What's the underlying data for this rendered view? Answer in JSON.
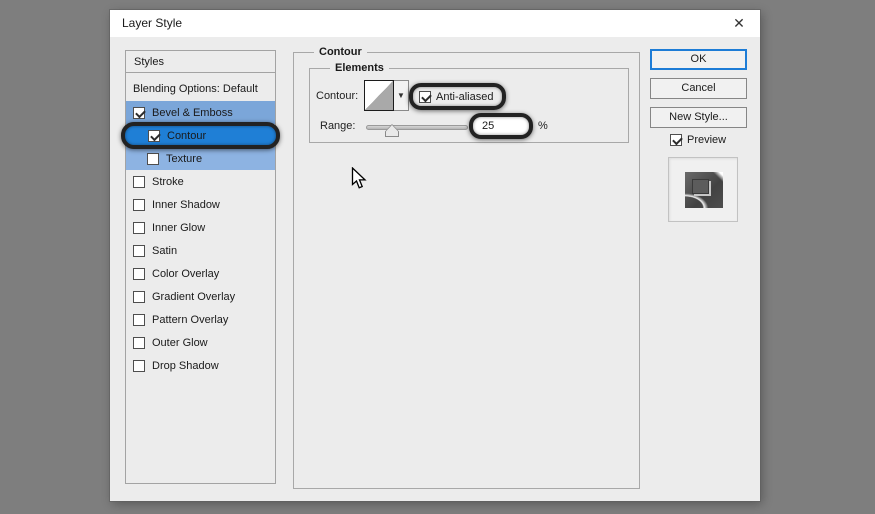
{
  "window": {
    "title": "Layer Style"
  },
  "icons": {
    "close": "✕",
    "dropdown_arrow": "▼"
  },
  "colors": {
    "desktop_background": "#7e7e7e",
    "dialog_background": "#ececec",
    "titlebar_background": "#ffffff",
    "selected_row_blue": "#1f7fd6",
    "group_row_blue": "#7ba6d9",
    "sub_row_blue": "#8db3e2",
    "annotation_ring": "#222222",
    "ok_focus_border": "#1d7cd6"
  },
  "sidebar": {
    "header": "Styles",
    "items": [
      {
        "label": "Blending Options: Default",
        "checkbox": null,
        "highlight": null,
        "indent": false,
        "annotated": false
      },
      {
        "label": "Bevel & Emboss",
        "checkbox": true,
        "highlight": "#7ba6d9",
        "indent": false,
        "annotated": false
      },
      {
        "label": "Contour",
        "checkbox": true,
        "highlight": "#1f7fd6",
        "indent": true,
        "annotated": true
      },
      {
        "label": "Texture",
        "checkbox": false,
        "highlight": "#8db3e2",
        "indent": true,
        "annotated": false
      },
      {
        "label": "Stroke",
        "checkbox": false,
        "highlight": null,
        "indent": false,
        "annotated": false
      },
      {
        "label": "Inner Shadow",
        "checkbox": false,
        "highlight": null,
        "indent": false,
        "annotated": false
      },
      {
        "label": "Inner Glow",
        "checkbox": false,
        "highlight": null,
        "indent": false,
        "annotated": false
      },
      {
        "label": "Satin",
        "checkbox": false,
        "highlight": null,
        "indent": false,
        "annotated": false
      },
      {
        "label": "Color Overlay",
        "checkbox": false,
        "highlight": null,
        "indent": false,
        "annotated": false
      },
      {
        "label": "Gradient Overlay",
        "checkbox": false,
        "highlight": null,
        "indent": false,
        "annotated": false
      },
      {
        "label": "Pattern Overlay",
        "checkbox": false,
        "highlight": null,
        "indent": false,
        "annotated": false
      },
      {
        "label": "Outer Glow",
        "checkbox": false,
        "highlight": null,
        "indent": false,
        "annotated": false
      },
      {
        "label": "Drop Shadow",
        "checkbox": false,
        "highlight": null,
        "indent": false,
        "annotated": false
      }
    ]
  },
  "main": {
    "group_title": "Contour",
    "elements_group_title": "Elements",
    "contour_label": "Contour:",
    "antialiased_label": "Anti-aliased",
    "antialiased_checked": true,
    "range_label": "Range:",
    "range_value": "25",
    "range_unit": "%",
    "range_percent": 25
  },
  "actions": {
    "ok": "OK",
    "cancel": "Cancel",
    "new_style": "New Style...",
    "preview_label": "Preview",
    "preview_checked": true
  }
}
